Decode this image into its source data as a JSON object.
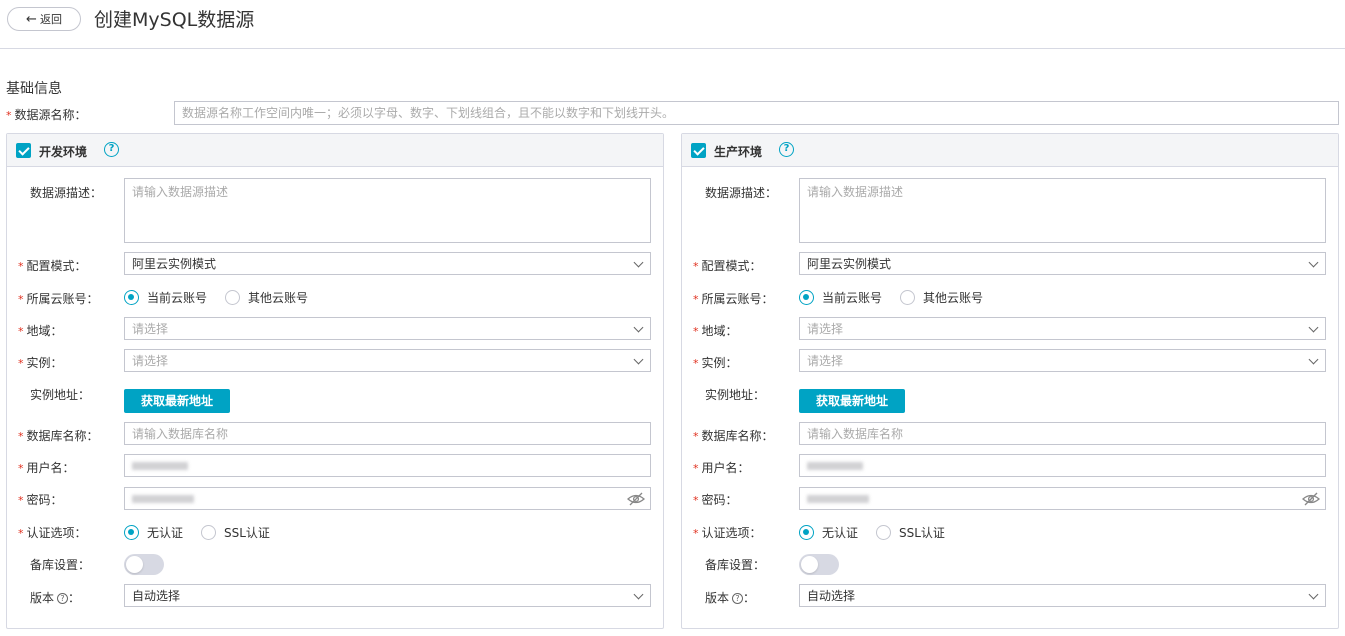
{
  "header": {
    "back_label": "返回",
    "title": "创建MySQL数据源"
  },
  "basic": {
    "section_title": "基础信息",
    "name_label": "数据源名称：",
    "name_placeholder": "数据源名称工作空间内唯一；必须以字母、数字、下划线组合，且不能以数字和下划线开头。"
  },
  "dev": {
    "title": "开发环境",
    "checked": true,
    "desc_label": "数据源描述：",
    "desc_placeholder": "请输入数据源描述",
    "mode_label": "配置模式：",
    "mode_value": "阿里云实例模式",
    "account_label": "所属云账号：",
    "account_options": [
      "当前云账号",
      "其他云账号"
    ],
    "account_selected": "当前云账号",
    "region_label": "地域：",
    "region_placeholder": "请选择",
    "instance_label": "实例：",
    "instance_placeholder": "请选择",
    "address_label": "实例地址：",
    "fetch_button": "获取最新地址",
    "db_label": "数据库名称：",
    "db_placeholder": "请输入数据库名称",
    "user_label": "用户名：",
    "pwd_label": "密码：",
    "auth_label": "认证选项：",
    "auth_options": [
      "无认证",
      "SSL认证"
    ],
    "auth_selected": "无认证",
    "backup_label": "备库设置：",
    "backup_enabled": false,
    "version_label": "版本",
    "version_suffix": "：",
    "version_value": "自动选择"
  },
  "prod": {
    "title": "生产环境",
    "checked": true,
    "desc_label": "数据源描述：",
    "desc_placeholder": "请输入数据源描述",
    "mode_label": "配置模式：",
    "mode_value": "阿里云实例模式",
    "account_label": "所属云账号：",
    "account_options": [
      "当前云账号",
      "其他云账号"
    ],
    "account_selected": "当前云账号",
    "region_label": "地域：",
    "region_placeholder": "请选择",
    "instance_label": "实例：",
    "instance_placeholder": "请选择",
    "address_label": "实例地址：",
    "fetch_button": "获取最新地址",
    "db_label": "数据库名称：",
    "db_placeholder": "请输入数据库名称",
    "user_label": "用户名：",
    "pwd_label": "密码：",
    "auth_label": "认证选项：",
    "auth_options": [
      "无认证",
      "SSL认证"
    ],
    "auth_selected": "无认证",
    "backup_label": "备库设置：",
    "backup_enabled": false,
    "version_label": "版本",
    "version_suffix": "：",
    "version_value": "自动选择"
  },
  "colors": {
    "accent": "#00a3c4",
    "required": "#e0301e",
    "border": "#c4c6cf",
    "panel_header": "#f4f5f7"
  }
}
